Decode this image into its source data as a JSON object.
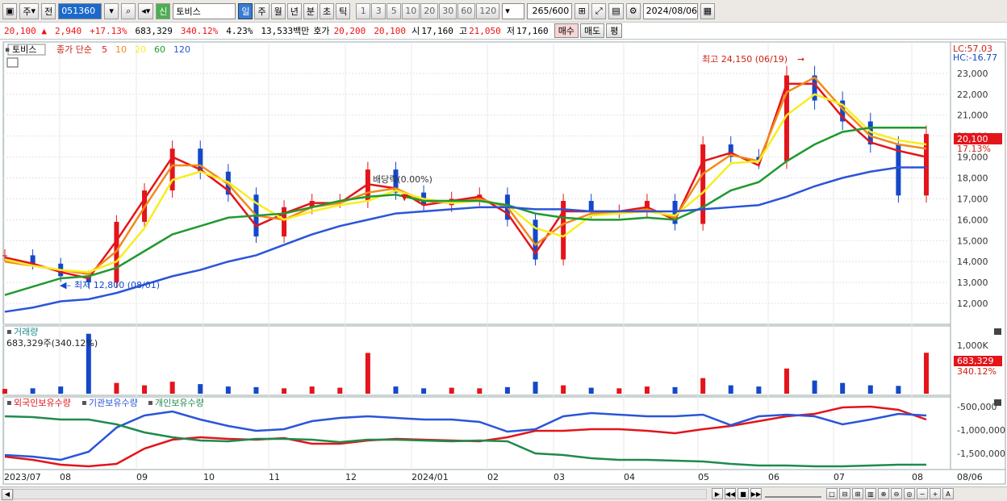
{
  "toolbar": {
    "market": "주",
    "prev_label": "전",
    "code": "051360",
    "signal_label": "신",
    "stock_name": "토비스",
    "periods": [
      "일",
      "주",
      "월",
      "년",
      "분",
      "초",
      "틱"
    ],
    "active_period": "일",
    "intervals": [
      "1",
      "3",
      "5",
      "10",
      "20",
      "30",
      "60",
      "120"
    ],
    "count": "265",
    "count_total": "/600",
    "date": "2024/08/06"
  },
  "quote": {
    "price": "20,100",
    "change": "2,940",
    "change_pct": "+17.13%",
    "volume": "683,329",
    "volume_ratio": "340.12%",
    "turnover_pct": "4.23%",
    "amount": "13,533백만",
    "bid_label": "호가",
    "ask": "20,200",
    "bid": "20,100",
    "open_label": "시",
    "open": "17,160",
    "high_label": "고",
    "high": "21,050",
    "low_label": "저",
    "low": "17,160",
    "buy_label": "매수",
    "sell_label": "매도",
    "eval_label": "평"
  },
  "price_panel": {
    "name_tag": "토비스",
    "legend_prefix": "종가 단순",
    "ma_legend": [
      {
        "period": "5",
        "color": "#e4141b"
      },
      {
        "period": "10",
        "color": "#f08a1a"
      },
      {
        "period": "20",
        "color": "#f7ee20"
      },
      {
        "period": "60",
        "color": "#1f9a2e"
      },
      {
        "period": "120",
        "color": "#2a55d8"
      }
    ],
    "lc_label": "LC:57.03",
    "hc_label": "HC:-16.77",
    "last_price_tag": "20,100",
    "last_pct_tag": "17.13%",
    "y_ticks": [
      "23,000",
      "22,000",
      "21,000",
      "20,000",
      "19,000",
      "18,000",
      "17,000",
      "16,000",
      "15,000",
      "14,000",
      "13,000",
      "12,000"
    ],
    "annotations": {
      "high": "최고 24,150 (06/19)",
      "low": "최저 12,800 (08/01)",
      "dividend": "배당락(0.00%)"
    }
  },
  "volume_panel": {
    "title": "거래량",
    "value_label": "683,329주(340.12%)",
    "y_tick": "1,000K",
    "last_tag": "683,329",
    "last_pct_tag": "340.12%"
  },
  "holdings_panel": {
    "legend": [
      {
        "label": "외국인보유수량",
        "color": "#e4141b"
      },
      {
        "label": "기관보유수량",
        "color": "#2a55d8"
      },
      {
        "label": "개인보유수량",
        "color": "#1f8a4e"
      }
    ],
    "y_ticks": [
      "-500,000",
      "-1,000,000",
      "-1,500,000"
    ]
  },
  "x_axis": {
    "labels": [
      "2023/07",
      "08",
      "09",
      "10",
      "11",
      "12",
      "2024/01",
      "02",
      "03",
      "04",
      "05",
      "06",
      "07",
      "08"
    ],
    "right_label": "08/06"
  },
  "colors": {
    "up": "#e4141b",
    "down": "#1448c8",
    "ma5": "#e4141b",
    "ma10": "#f08a1a",
    "ma20": "#f7ee20",
    "ma60": "#1f9a2e",
    "ma120": "#2a55d8"
  },
  "chart_data": {
    "type": "line",
    "title": "토비스",
    "x": [
      "2023/07/03",
      "2023/07/17",
      "2023/07/31",
      "2023/08/01",
      "2023/08/14",
      "2023/08/28",
      "2023/09/04",
      "2023/09/11",
      "2023/09/25",
      "2023/10/10",
      "2023/10/23",
      "2023/11/06",
      "2023/11/20",
      "2023/12/04",
      "2023/12/18",
      "2024/01/02",
      "2024/01/15",
      "2024/01/29",
      "2024/02/05",
      "2024/02/19",
      "2024/03/04",
      "2024/03/18",
      "2024/04/01",
      "2024/04/15",
      "2024/04/29",
      "2024/05/13",
      "2024/05/27",
      "2024/06/10",
      "2024/06/19",
      "2024/07/01",
      "2024/07/15",
      "2024/07/29",
      "2024/08/05",
      "2024/08/06"
    ],
    "series": [
      {
        "name": "close",
        "values": [
          14300,
          13900,
          13300,
          13000,
          15900,
          17400,
          19400,
          18300,
          17200,
          15200,
          16600,
          16900,
          16900,
          18400,
          17300,
          16700,
          17000,
          17200,
          16000,
          14100,
          16900,
          16400,
          16400,
          16900,
          15800,
          19600,
          19000,
          18800,
          22900,
          21700,
          20700,
          19600,
          17160,
          20100
        ]
      },
      {
        "name": "5",
        "values": [
          14200,
          13900,
          13500,
          13200,
          15000,
          17000,
          19000,
          18400,
          17400,
          15700,
          16300,
          16800,
          16800,
          17700,
          17500,
          16700,
          16900,
          17100,
          16300,
          14400,
          16400,
          16400,
          16400,
          16600,
          16000,
          18800,
          19200,
          18600,
          22500,
          22500,
          20900,
          19700,
          19300,
          19000
        ]
      },
      {
        "name": "10",
        "values": [
          14000,
          13800,
          13600,
          13400,
          14500,
          16600,
          18600,
          18600,
          17700,
          16200,
          16000,
          16600,
          16800,
          17300,
          17500,
          16900,
          16800,
          17000,
          16600,
          14800,
          15800,
          16300,
          16300,
          16500,
          16100,
          18200,
          19100,
          18800,
          22100,
          22800,
          21300,
          20000,
          19600,
          19400
        ]
      },
      {
        "name": "20",
        "values": [
          14100,
          13800,
          13600,
          13500,
          14000,
          15600,
          17900,
          18300,
          17800,
          16800,
          16000,
          16400,
          16700,
          16900,
          17400,
          17000,
          16800,
          16900,
          16700,
          15600,
          15200,
          16200,
          16300,
          16400,
          16200,
          17300,
          18700,
          18800,
          21000,
          22000,
          21500,
          20200,
          19800,
          19600
        ]
      },
      {
        "name": "60",
        "values": [
          12400,
          12800,
          13200,
          13300,
          13700,
          14500,
          15300,
          15700,
          16100,
          16200,
          16300,
          16600,
          16900,
          17100,
          17200,
          16900,
          16900,
          16900,
          16700,
          16300,
          16100,
          16000,
          16000,
          16100,
          16000,
          16600,
          17400,
          17800,
          18800,
          19600,
          20200,
          20400,
          20400,
          20400
        ]
      },
      {
        "name": "120",
        "values": [
          11600,
          11800,
          12100,
          12200,
          12500,
          12900,
          13300,
          13600,
          14000,
          14300,
          14800,
          15300,
          15700,
          16000,
          16300,
          16400,
          16500,
          16600,
          16600,
          16500,
          16500,
          16400,
          16400,
          16400,
          16400,
          16500,
          16600,
          16700,
          17100,
          17600,
          18000,
          18300,
          18500,
          18500
        ]
      }
    ],
    "ylim": [
      11000,
      24500
    ],
    "volume": [
      80,
      90,
      120,
      1000,
      180,
      140,
      200,
      160,
      120,
      110,
      90,
      120,
      100,
      680,
      120,
      90,
      100,
      90,
      110,
      200,
      140,
      100,
      90,
      120,
      110,
      260,
      140,
      120,
      420,
      220,
      180,
      140,
      130,
      683
    ]
  }
}
